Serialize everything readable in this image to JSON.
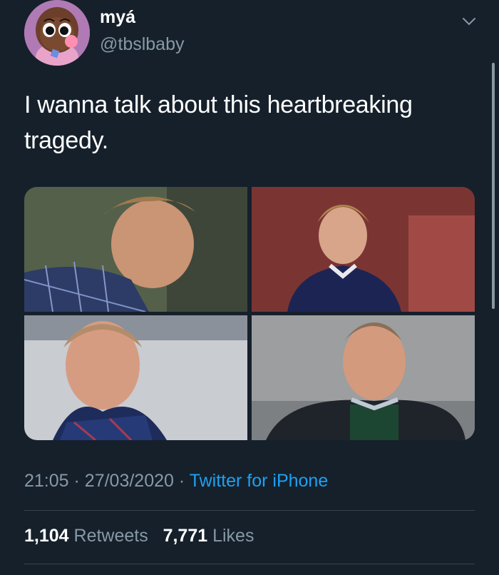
{
  "tweet": {
    "display_name": "myá",
    "handle": "@tbslbaby",
    "text": "I wanna talk about this heartbreaking tragedy.",
    "time": "21:05",
    "separator": "·",
    "date": "27/03/2020",
    "source": "Twitter for iPhone",
    "retweets_count": "1,104",
    "retweets_label": "Retweets",
    "likes_count": "7,771",
    "likes_label": "Likes"
  },
  "icons": {
    "menu": "chevron-down-icon",
    "avatar": "avatar"
  },
  "colors": {
    "background": "#15202b",
    "text": "#ffffff",
    "secondary": "#8899a6",
    "link": "#1da1f2",
    "divider": "#38444d"
  },
  "photos": [
    {
      "name": "photo-young-man-plaid-shirt"
    },
    {
      "name": "photo-young-man-navy-sweater"
    },
    {
      "name": "photo-man-scarf"
    },
    {
      "name": "photo-man-dark-jacket"
    }
  ]
}
